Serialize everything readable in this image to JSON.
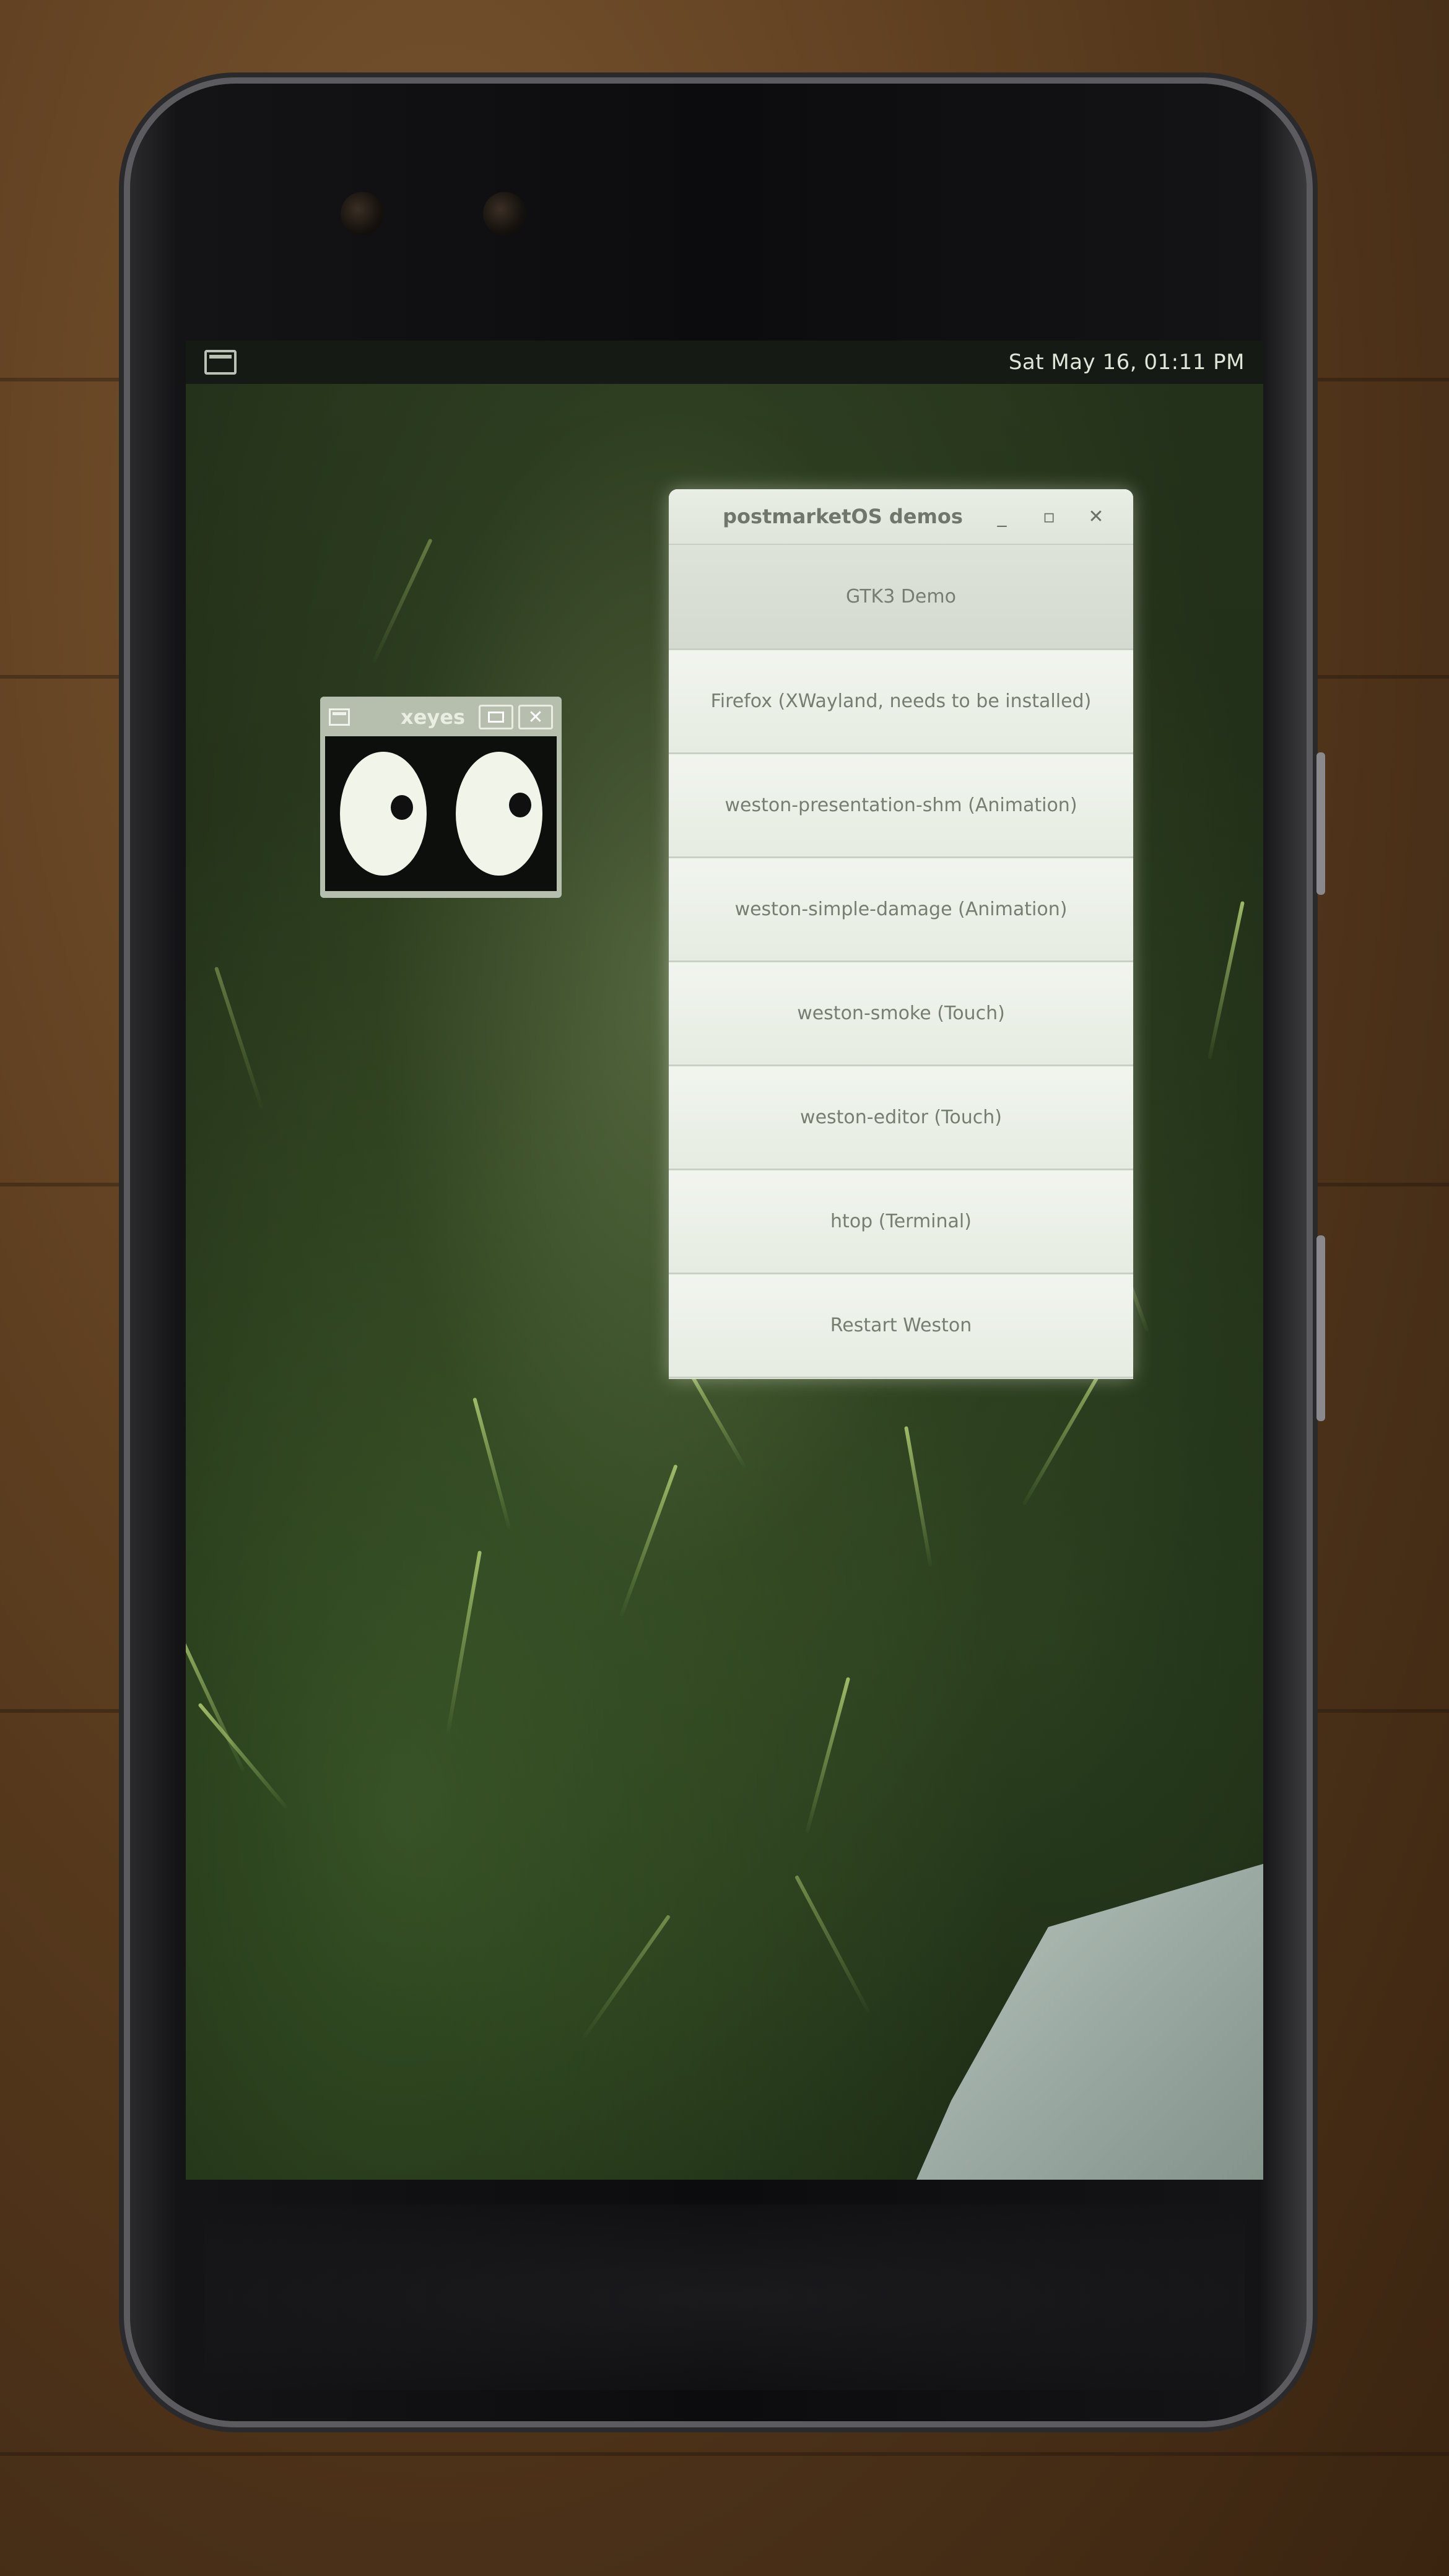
{
  "status_bar": {
    "clock": "Sat May 16, 01:11 PM",
    "launcher_icon": "window-icon"
  },
  "xeyes": {
    "title": "xeyes",
    "menu_icon": "window-menu-icon",
    "maximize_icon": "maximize-icon",
    "close_label": "✕"
  },
  "demo_window": {
    "title": "postmarketOS demos",
    "minimize_label": "_",
    "maximize_label": "▫",
    "close_label": "✕",
    "items": [
      {
        "label": "GTK3 Demo"
      },
      {
        "label": "Firefox (XWayland, needs to be installed)"
      },
      {
        "label": "weston-presentation-shm (Animation)"
      },
      {
        "label": "weston-simple-damage (Animation)"
      },
      {
        "label": "weston-smoke (Touch)"
      },
      {
        "label": "weston-editor (Touch)"
      },
      {
        "label": "htop (Terminal)"
      },
      {
        "label": "Restart Weston"
      }
    ]
  },
  "colors": {
    "window_bg": "#e7ede2",
    "window_text": "#767e72",
    "topbar_bg": "#161a14",
    "wallpaper_green": "#26331c"
  }
}
